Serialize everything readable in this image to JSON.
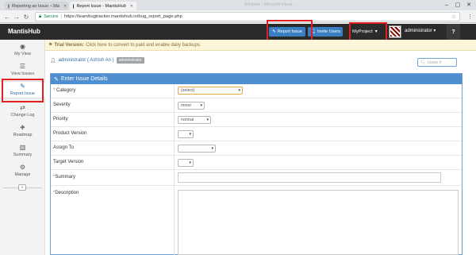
{
  "browser": {
    "tabs": [
      {
        "label": "Reporting an Issue – Ma",
        "active": false
      },
      {
        "label": "Report Issue - MantisHub",
        "active": true
      }
    ],
    "ghost_title": "Windows - Microsoft Visual...",
    "secure_label": "Secure",
    "url": "https://learnbugtracker.mantishub.io/bug_report_page.php"
  },
  "header": {
    "brand": "MantisHub",
    "report_issue_label": "Report Issue",
    "invite_users_label": "Invite Users",
    "project_label": "MyProject",
    "user_label": "administrator",
    "help_label": "?"
  },
  "banner": {
    "bold": "Trial Version:",
    "text": "Click here to convert to paid and enable daily backups."
  },
  "sidebar": {
    "items": [
      {
        "label": "My View",
        "icon": "dashboard-icon"
      },
      {
        "label": "View Issues",
        "icon": "list-icon"
      },
      {
        "label": "Report Issue",
        "icon": "edit-icon"
      },
      {
        "label": "Change Log",
        "icon": "retweet-icon"
      },
      {
        "label": "Roadmap",
        "icon": "road-icon"
      },
      {
        "label": "Summary",
        "icon": "bar-chart-icon"
      },
      {
        "label": "Manage",
        "icon": "gears-icon"
      }
    ],
    "collapse_label": "«"
  },
  "user": {
    "name": "administrator ( Ashish An )",
    "role": "administrator"
  },
  "search": {
    "placeholder": "Issue #"
  },
  "form": {
    "title": "Enter Issue Details",
    "fields": {
      "category": {
        "label": "Category",
        "value": "(select)",
        "required": true
      },
      "severity": {
        "label": "Severity",
        "value": "minor"
      },
      "priority": {
        "label": "Priority",
        "value": "normal"
      },
      "product_version": {
        "label": "Product Version",
        "value": ""
      },
      "assign_to": {
        "label": "Assign To",
        "value": ""
      },
      "target_version": {
        "label": "Target Version",
        "value": ""
      },
      "summary": {
        "label": "Summary",
        "value": "",
        "required": true
      },
      "description": {
        "label": "Description",
        "value": "",
        "required": true
      }
    }
  },
  "colors": {
    "accent": "#4f8fd0",
    "header_bg": "#2b2b2b",
    "annotation_red": "#e02020",
    "banner_bg": "#fbf5d9"
  }
}
